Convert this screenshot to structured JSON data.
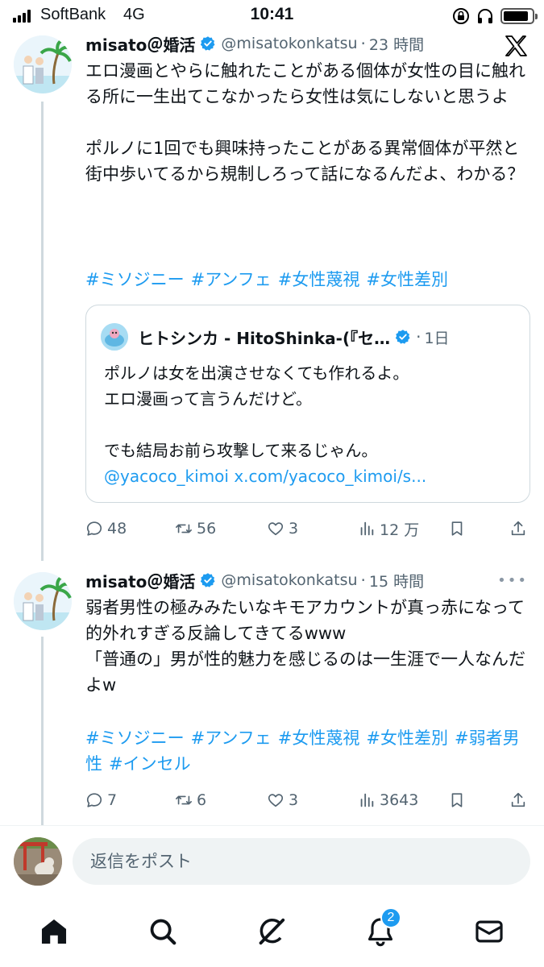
{
  "status_bar": {
    "carrier": "SoftBank",
    "network": "4G",
    "time": "10:41"
  },
  "tweets": [
    {
      "display_name": "misato＠婚活",
      "handle": "@misatokonkatsu",
      "time": "23 時間",
      "text": "エロ漫画とやらに触れたことがある個体が女性の目に触れる所に一生出てこなかったら女性は気にしないと思うよ\n\nポルノに1回でも興味持ったことがある異常個体が平然と街中歩いてるから規制しろって話になるんだよ、わかる？",
      "hashtags": [
        "#ミソジニー",
        "#アンフェ",
        "#女性蔑視",
        "#女性差別"
      ],
      "quote": {
        "display_name": "ヒトシンカ - HitoShinka-(『セ…",
        "time": "1日",
        "text": "ポルノは女を出演させなくても作れるよ。\nエロ漫画って言うんだけど。\n\nでも結局お前ら攻撃して来るじゃん。",
        "link": "@yacoco_kimoi x.com/yacoco_kimoi/s..."
      },
      "actions": {
        "replies": "48",
        "retweets": "56",
        "likes": "3",
        "views": "12 万"
      }
    },
    {
      "display_name": "misato＠婚活",
      "handle": "@misatokonkatsu",
      "time": "15 時間",
      "text": "弱者男性の極みみたいなキモアカウントが真っ赤になって的外れすぎる反論してきてるwww\n「普通の」男が性的魅力を感じるのは一生涯で一人なんだよw",
      "hashtags": [
        "#ミソジニー",
        "#アンフェ",
        "#女性蔑視",
        "#女性差別",
        "#弱者男性",
        "#インセル"
      ],
      "actions": {
        "replies": "7",
        "retweets": "6",
        "likes": "3",
        "views": "3643"
      }
    }
  ],
  "reply": {
    "placeholder": "返信をポスト"
  },
  "nav": {
    "notifications_badge": "2"
  },
  "colors": {
    "link": "#1d9bf0",
    "verified": "#1d9bf0",
    "secondary_text": "#536471"
  },
  "icons": [
    "x-logo-icon",
    "verified-icon",
    "reply-icon",
    "retweet-icon",
    "like-icon",
    "views-icon",
    "bookmark-icon",
    "share-icon",
    "home-icon",
    "search-icon",
    "grok-icon",
    "notifications-icon",
    "messages-icon"
  ]
}
